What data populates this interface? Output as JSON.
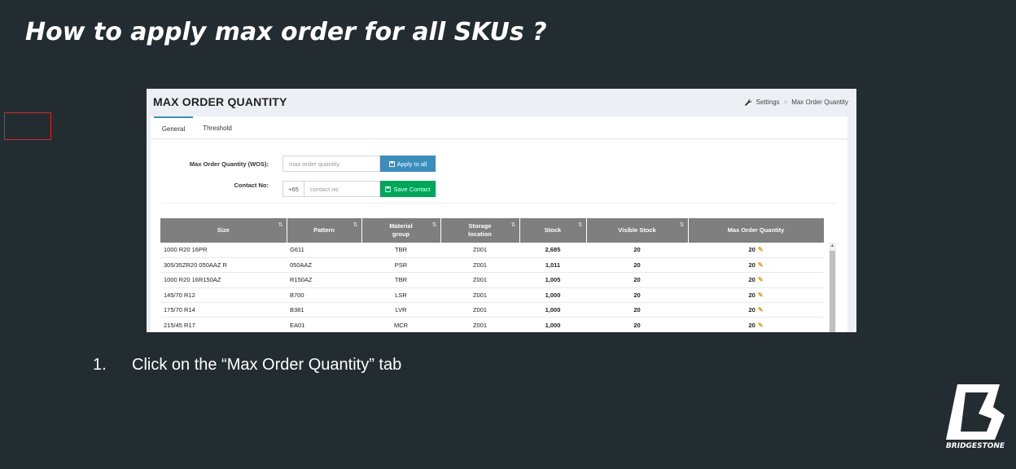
{
  "slide": {
    "title": "How to apply max order for all SKUs ?",
    "step_number": "1.",
    "step_text": "Click on the “Max Order Quantity” tab",
    "brand_name": "BRIDGESTONE"
  },
  "app": {
    "page_title": "MAX ORDER QUANTITY",
    "breadcrumb": [
      "Settings",
      "Max Order Quantity"
    ],
    "tabs": [
      {
        "label": "General",
        "active": true
      },
      {
        "label": "Threshold",
        "active": false
      }
    ],
    "form": {
      "max_qty_label": "Max Order Quantity (WOS):",
      "max_qty_placeholder": "max order quantity",
      "apply_button": "Apply to all",
      "contact_label": "Contact No:",
      "contact_prefix": "+65",
      "contact_placeholder": "contact no",
      "save_button": "Save Contact"
    },
    "table": {
      "columns": [
        "Size",
        "Pattern",
        "Material group",
        "Storage location",
        "Stock",
        "Visible Stock",
        "Max Order Quantity"
      ],
      "rows": [
        [
          "1000 R20 16PR",
          "G611",
          "TBR",
          "Z001",
          "2,685",
          "20",
          "20"
        ],
        [
          "305/35ZR20 050AAZ R",
          "050AAZ",
          "PSR",
          "Z001",
          "1,011",
          "20",
          "20"
        ],
        [
          "1000 R20 16R150AZ",
          "R150AZ",
          "TBR",
          "Z001",
          "1,005",
          "20",
          "20"
        ],
        [
          "145/70 R12",
          "B700",
          "LSR",
          "Z001",
          "1,000",
          "20",
          "20"
        ],
        [
          "175/70 R14",
          "B381",
          "LVR",
          "Z001",
          "1,000",
          "20",
          "20"
        ],
        [
          "215/45 R17",
          "EA01",
          "MCR",
          "Z001",
          "1,000",
          "20",
          "20"
        ]
      ]
    }
  },
  "colors": {
    "background": "#232c30",
    "table_header": "#7f7f7f",
    "apply_button": "#3c8dbc",
    "save_button": "#00a65a",
    "highlight": "#d22b2b",
    "edit_icon": "#f39c12"
  }
}
